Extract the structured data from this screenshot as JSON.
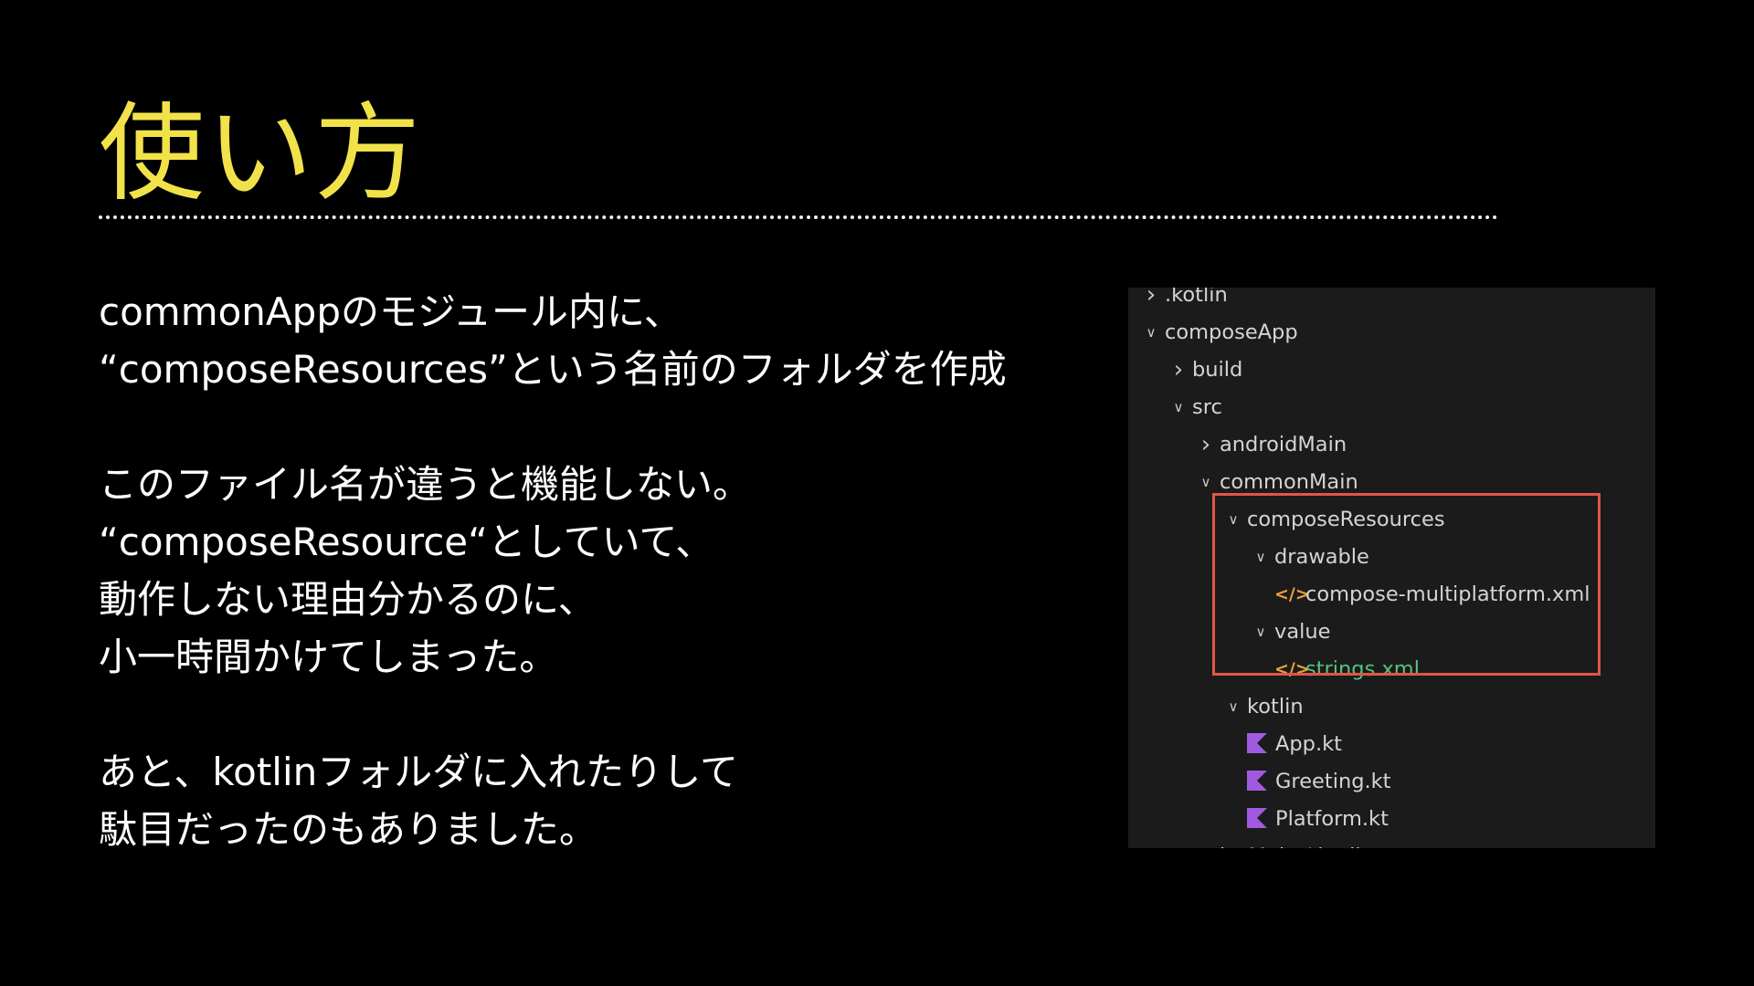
{
  "slide": {
    "title": "使い方",
    "paragraphs": [
      [
        "commonAppのモジュール内に、",
        "“composeResources”という名前のフォルダを作成"
      ],
      [
        "このファイル名が違うと機能しない。",
        "“composeResource“としていて、",
        "動作しない理由分かるのに、",
        "小一時間かけてしまった。"
      ],
      [
        "あと、kotlinフォルダに入れたりして",
        "駄目だったのもありました。"
      ]
    ]
  },
  "file_tree": {
    "rows": [
      {
        "label": ".kotlin",
        "depth": 0,
        "chevron": "right",
        "icon": "chevron-right-icon"
      },
      {
        "label": "composeApp",
        "depth": 0,
        "chevron": "down",
        "icon": "chevron-down-icon"
      },
      {
        "label": "build",
        "depth": 1,
        "chevron": "right",
        "icon": "chevron-right-icon"
      },
      {
        "label": "src",
        "depth": 1,
        "chevron": "down",
        "icon": "chevron-down-icon"
      },
      {
        "label": "androidMain",
        "depth": 2,
        "chevron": "right",
        "icon": "chevron-right-icon"
      },
      {
        "label": "commonMain",
        "depth": 2,
        "chevron": "down",
        "icon": "chevron-down-icon"
      },
      {
        "label": "composeResources",
        "depth": 3,
        "chevron": "down",
        "icon": "chevron-down-icon"
      },
      {
        "label": "drawable",
        "depth": 4,
        "chevron": "down",
        "icon": "chevron-down-icon"
      },
      {
        "label": "compose-multiplatform.xml",
        "depth": 5,
        "file": "xml",
        "icon": "xml-file-icon"
      },
      {
        "label": "value",
        "depth": 4,
        "chevron": "down",
        "icon": "chevron-down-icon"
      },
      {
        "label": "strings.xml",
        "depth": 5,
        "file": "xml",
        "icon": "xml-file-icon",
        "color": "#56c27a"
      },
      {
        "label": "kotlin",
        "depth": 3,
        "chevron": "down",
        "icon": "chevron-down-icon"
      },
      {
        "label": "App.kt",
        "depth": 4,
        "file": "kt",
        "icon": "kotlin-file-icon"
      },
      {
        "label": "Greeting.kt",
        "depth": 4,
        "file": "kt",
        "icon": "kotlin-file-icon"
      },
      {
        "label": "Platform.kt",
        "depth": 4,
        "file": "kt",
        "icon": "kotlin-file-icon"
      },
      {
        "label": "iosMain / kotlin",
        "depth": 2,
        "chevron": "right",
        "icon": "chevron-right-icon"
      }
    ],
    "highlight_color": "#e0564a",
    "xml_icon_color": "#e8a33a",
    "kotlin_icon_color": "#a05ae0"
  }
}
